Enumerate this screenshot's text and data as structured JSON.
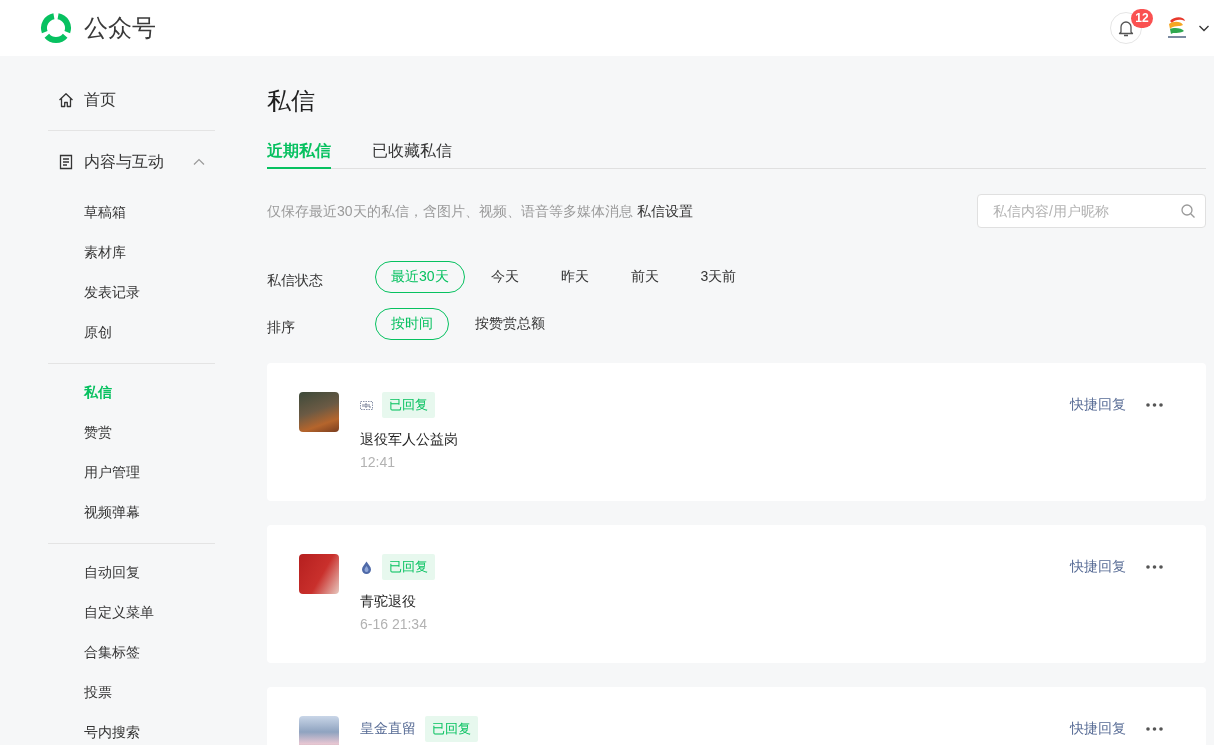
{
  "header": {
    "logo_text": "公众号",
    "notification_badge": "12"
  },
  "sidebar": {
    "home": {
      "label": "首页",
      "selected": false
    },
    "section": {
      "label": "内容与互动",
      "expanded": true,
      "groups": [
        [
          {
            "label": "草稿箱",
            "selected": false
          },
          {
            "label": "素材库",
            "selected": false
          },
          {
            "label": "发表记录",
            "selected": false
          },
          {
            "label": "原创",
            "selected": false
          }
        ],
        [
          {
            "label": "私信",
            "selected": true
          },
          {
            "label": "赞赏",
            "selected": false
          },
          {
            "label": "用户管理",
            "selected": false
          },
          {
            "label": "视频弹幕",
            "selected": false
          }
        ],
        [
          {
            "label": "自动回复",
            "selected": false
          },
          {
            "label": "自定义菜单",
            "selected": false
          },
          {
            "label": "合集标签",
            "selected": false
          },
          {
            "label": "投票",
            "selected": false
          },
          {
            "label": "号内搜索",
            "selected": false
          }
        ]
      ]
    }
  },
  "page": {
    "title": "私信"
  },
  "tabs": [
    {
      "label": "近期私信",
      "selected": true
    },
    {
      "label": "已收藏私信",
      "selected": false
    }
  ],
  "notice": {
    "text": "仅保存最近30天的私信，含图片、视频、语音等多媒体消息",
    "link": "私信设置"
  },
  "search": {
    "placeholder": "私信内容/用户昵称"
  },
  "filters": [
    {
      "label": "私信状态",
      "options": [
        {
          "label": "最近30天",
          "selected": true
        },
        {
          "label": "今天",
          "selected": false
        },
        {
          "label": "昨天",
          "selected": false
        },
        {
          "label": "前天",
          "selected": false
        },
        {
          "label": "3天前",
          "selected": false
        }
      ]
    },
    {
      "label": "排序",
      "options": [
        {
          "label": "按时间",
          "selected": true
        },
        {
          "label": "按赞赏总额",
          "selected": false
        }
      ]
    }
  ],
  "messages": [
    {
      "sender": {
        "kind": "sticker"
      },
      "status": "已回复",
      "text": "退役军人公益岗",
      "time": "12:41",
      "action": "快捷回复"
    },
    {
      "sender": {
        "kind": "drop"
      },
      "status": "已回复",
      "text": "青驼退役",
      "time": "6-16 21:34",
      "action": "快捷回复"
    },
    {
      "sender": {
        "kind": "text",
        "text": "皇金直留"
      },
      "status": "已回复",
      "action": "快捷回复"
    }
  ]
}
